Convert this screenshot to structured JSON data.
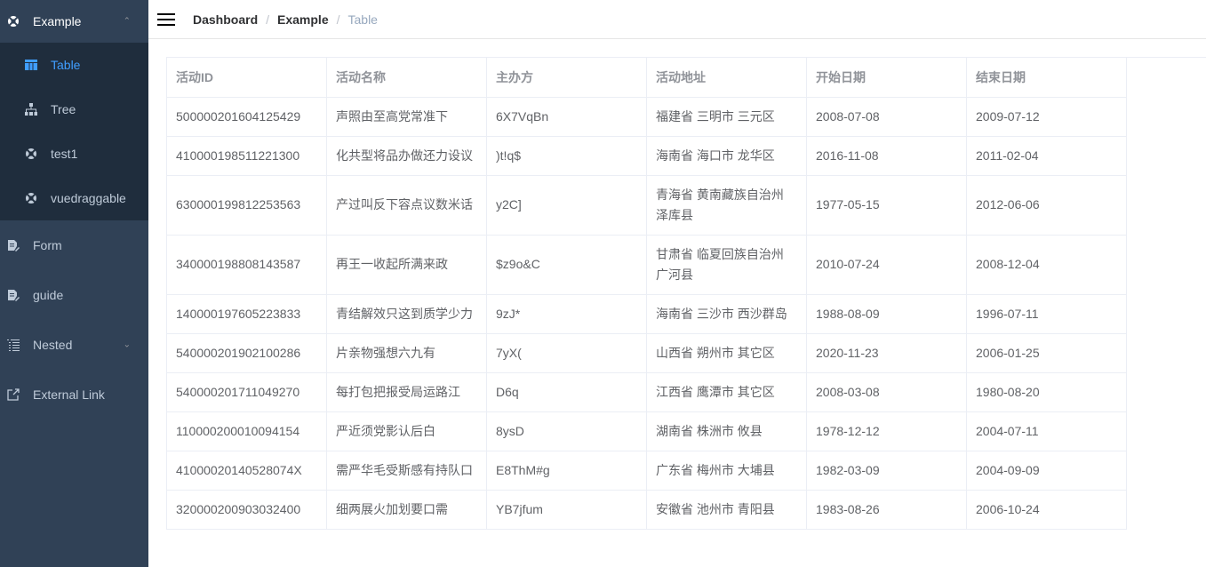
{
  "sidebar": {
    "example": {
      "label": "Example",
      "icon": "example-icon",
      "expanded": true
    },
    "example_children": [
      {
        "label": "Table",
        "icon": "table-icon",
        "active": true
      },
      {
        "label": "Tree",
        "icon": "tree-icon"
      },
      {
        "label": "test1",
        "icon": "example-icon"
      },
      {
        "label": "vuedraggable",
        "icon": "example-icon"
      }
    ],
    "items": [
      {
        "label": "Form",
        "icon": "form-icon"
      },
      {
        "label": "guide",
        "icon": "form-icon"
      },
      {
        "label": "Nested",
        "icon": "nested-icon",
        "has_children": true
      },
      {
        "label": "External Link",
        "icon": "link-icon"
      }
    ],
    "active_color": "#409eff"
  },
  "breadcrumb": {
    "items": [
      "Dashboard",
      "Example"
    ],
    "current": "Table",
    "separator": "/"
  },
  "table": {
    "headers": [
      "活动ID",
      "活动名称",
      "主办方",
      "活动地址",
      "开始日期",
      "结束日期"
    ],
    "rows": [
      [
        "500000201604125429",
        "声照由至高党常准下",
        "6X7VqBn",
        "福建省 三明市 三元区",
        "2008-07-08",
        "2009-07-12"
      ],
      [
        "410000198511221300",
        "化共型将品办做还力设议",
        ")t!q$",
        "海南省 海口市 龙华区",
        "2016-11-08",
        "2011-02-04"
      ],
      [
        "630000199812253563",
        "产过叫反下容点议数米话",
        "y2C]",
        "青海省 黄南藏族自治州 泽库县",
        "1977-05-15",
        "2012-06-06"
      ],
      [
        "340000198808143587",
        "再王一收起所满来政",
        "$z9o&C",
        "甘肃省 临夏回族自治州 广河县",
        "2010-07-24",
        "2008-12-04"
      ],
      [
        "140000197605223833",
        "青结解效只这到质学少力",
        "9zJ*",
        "海南省 三沙市 西沙群岛",
        "1988-08-09",
        "1996-07-11"
      ],
      [
        "540000201902100286",
        "片亲物强想六九有",
        "7yX(",
        "山西省 朔州市 其它区",
        "2020-11-23",
        "2006-01-25"
      ],
      [
        "540000201711049270",
        "每打包把报受局运路江",
        "D6q",
        "江西省 鹰潭市 其它区",
        "2008-03-08",
        "1980-08-20"
      ],
      [
        "110000200010094154",
        "严近须党影认后白",
        "8ysD",
        "湖南省 株洲市 攸县",
        "1978-12-12",
        "2004-07-11"
      ],
      [
        "41000020140528074X",
        "需严华毛受斯感有持队口",
        "E8ThM#g",
        "广东省 梅州市 大埔县",
        "1982-03-09",
        "2004-09-09"
      ],
      [
        "320000200903032400",
        "细两展火加划要口需",
        "YB7jfum",
        "安徽省 池州市 青阳县",
        "1983-08-26",
        "2006-10-24"
      ]
    ]
  }
}
